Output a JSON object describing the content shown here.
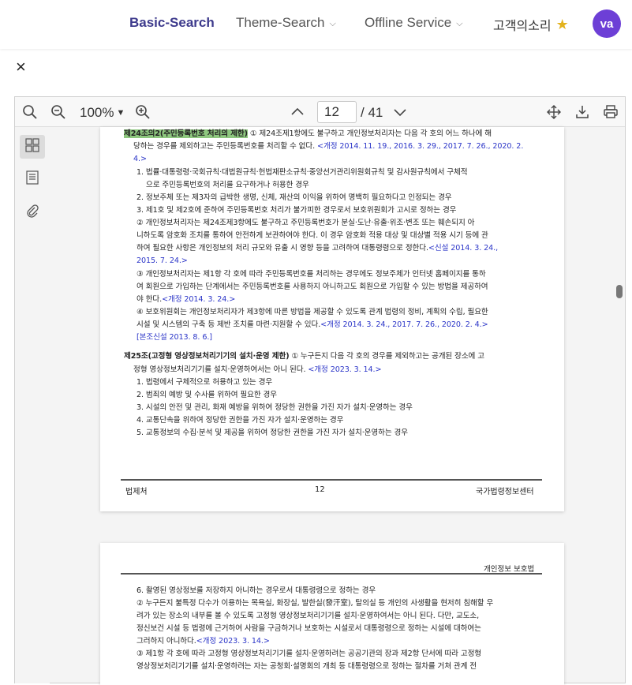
{
  "nav": {
    "basic_search": "Basic-Search",
    "theme_search": "Theme-Search",
    "offline_service": "Offline Service",
    "voice": "고객의소리",
    "avatar": "va"
  },
  "close_icon": "×",
  "toolbar": {
    "zoom": "100%",
    "page_current": "12",
    "page_total": "/ 41"
  },
  "page12": {
    "art24_title": "제24조의2(주민등록번호 처리의 제한)",
    "art24_intro_1": "① 제24조제1항에도 불구하고 개인정보처리자는 다음 각 호의 어느 하나에 해",
    "art24_intro_2a": "당하는 경우를 제외하고는 주민등록번호를 처리할 수 없다.",
    "art24_intro_2b": "<개정 2014. 11. 19., 2016. 3. 29., 2017. 7. 26., 2020. 2.",
    "art24_intro_3": "4.>",
    "art24_i1_1": "1. 법률·대통령령·국회규칙·대법원규칙·헌법재판소규칙·중앙선거관리위원회규칙 및 감사원규칙에서 구체적",
    "art24_i1_2": "으로 주민등록번호의 처리를 요구하거나 허용한 경우",
    "art24_i2": "2. 정보주체 또는 제3자의 급박한 생명, 신체, 재산의 이익을 위하여 명백히 필요하다고 인정되는 경우",
    "art24_i3": "3. 제1호 및 제2호에 준하여 주민등록번호 처리가 불가피한 경우로서 보호위원회가 고시로 정하는 경우",
    "art24_p2_1": "② 개인정보처리자는 제24조제3항에도 불구하고 주민등록번호가 분실·도난·유출·위조·변조 또는 훼손되지 아",
    "art24_p2_2": "니하도록 암호화 조치를 통하여 안전하게 보관하여야 한다. 이 경우 암호화 적용 대상 및 대상별 적용 시기 등에 관",
    "art24_p2_3a": "하여 필요한 사항은 개인정보의 처리 규모와 유출 시 영향 등을 고려하여 대통령령으로 정한다.",
    "art24_p2_3b": "<신설 2014. 3. 24.,",
    "art24_p2_4": "2015. 7. 24.>",
    "art24_p3_1": "③ 개인정보처리자는 제1항 각 호에 따라 주민등록번호를 처리하는 경우에도 정보주체가 인터넷 홈페이지를 통하",
    "art24_p3_2": "여 회원으로 가입하는 단계에서는 주민등록번호를 사용하지 아니하고도 회원으로 가입할 수 있는 방법을 제공하여",
    "art24_p3_3a": "야 한다.",
    "art24_p3_3b": "<개정 2014. 3. 24.>",
    "art24_p4_1": "④ 보호위원회는 개인정보처리자가 제3항에 따른 방법을 제공할 수 있도록 관계 법령의 정비, 계획의 수립, 필요한",
    "art24_p4_2a": "시설 및 시스템의 구축 등 제반 조치를 마련·지원할 수 있다.",
    "art24_p4_2b": "<개정 2014. 3. 24., 2017. 7. 26., 2020. 2. 4.>",
    "art24_note": "[본조신설 2013. 8. 6.]",
    "art25_title": "제25조(고정형 영상정보처리기기의 설치·운영 제한)",
    "art25_intro_1": "① 누구든지 다음 각 호의 경우를 제외하고는 공개된 장소에 고",
    "art25_intro_2a": "정형 영상정보처리기기를 설치·운영하여서는 아니 된다.",
    "art25_intro_2b": "<개정 2023. 3. 14.>",
    "art25_i1": "1. 법령에서 구체적으로 허용하고 있는 경우",
    "art25_i2": "2. 범죄의 예방 및 수사를 위하여 필요한 경우",
    "art25_i3": "3. 시설의 안전 및 관리, 화재 예방을 위하여 정당한 권한을 가진 자가 설치·운영하는 경우",
    "art25_i4": "4. 교통단속을 위하여 정당한 권한을 가진 자가 설치·운영하는 경우",
    "art25_i5": "5. 교통정보의 수집·분석 및 제공을 위하여 정당한 권한을 가진 자가 설치·운영하는 경우",
    "footer_left": "법제처",
    "footer_center": "12",
    "footer_right": "국가법령정보센터"
  },
  "page13": {
    "header_right": "개인정보 보호법",
    "l1": "6. 촬영된 영상정보를 저장하지 아니하는 경우로서 대통령령으로 정하는 경우",
    "l2": "② 누구든지 불특정 다수가 이용하는 목욕실, 화장실, 발한실(發汗室), 탈의실 등 개인의 사생활을 현저히 침해할 우",
    "l3": "려가 있는 장소의 내부를 볼 수 있도록 고정형 영상정보처리기기를 설치·운영하여서는 아니 된다. 다만, 교도소,",
    "l4": "정신보건 시설 등 법령에 근거하여 사람을 구금하거나 보호하는 시설로서 대통령령으로 정하는 시설에 대하여는",
    "l5a": "그러하지 아니하다.",
    "l5b": "<개정 2023. 3. 14.>",
    "l6": "③ 제1항 각 호에 따라 고정형 영상정보처리기기를 설치·운영하려는 공공기관의 장과 제2항 단서에 따라 고정형",
    "l7": "영상정보처리기기를 설치·운영하려는 자는 공청회·설명회의 개최 등 대통령령으로 정하는 절차를 거쳐 관계 전"
  }
}
